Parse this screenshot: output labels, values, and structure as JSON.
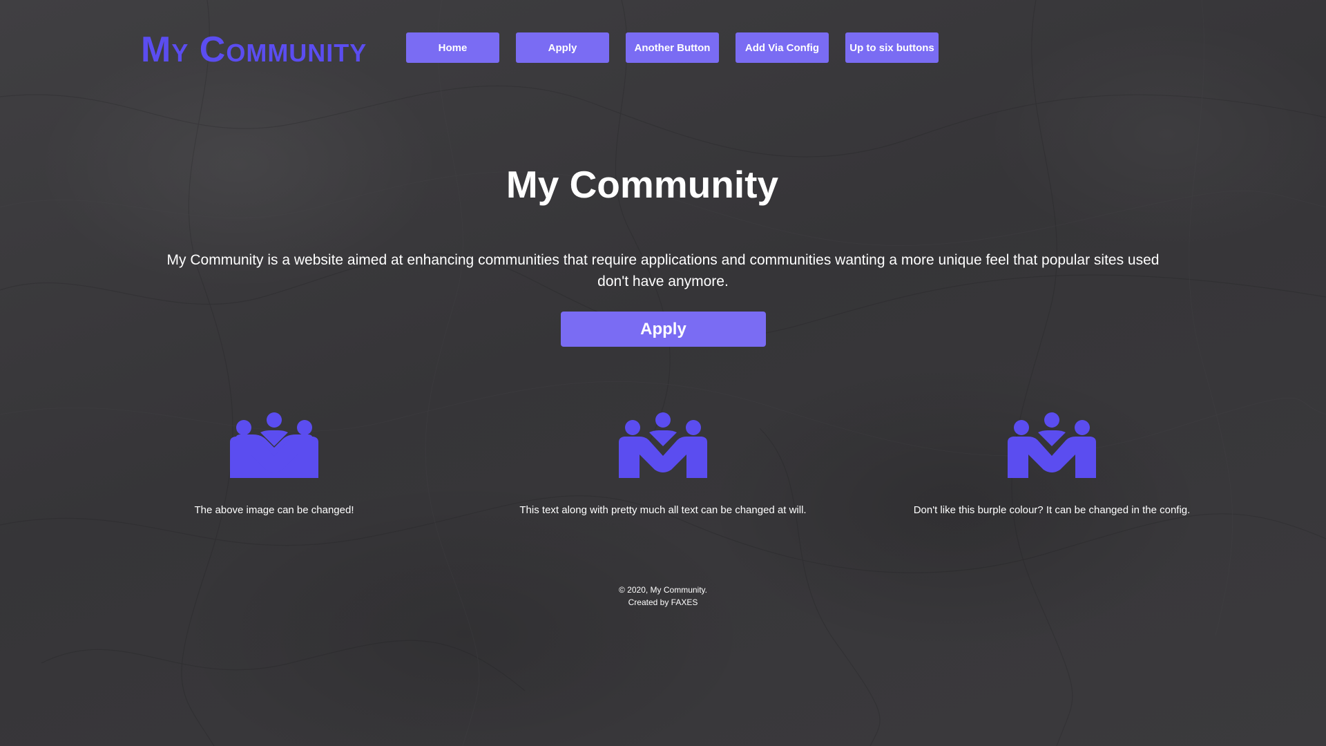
{
  "brand": {
    "logo_text": "My Community",
    "accent_color": "#5b4df0",
    "button_color": "#7a6cf3"
  },
  "nav": {
    "items": [
      {
        "label": "Home"
      },
      {
        "label": "Apply"
      },
      {
        "label": "Another Button"
      },
      {
        "label": "Add Via Config"
      },
      {
        "label": "Up to six buttons"
      }
    ]
  },
  "hero": {
    "title": "My Community",
    "description": "My Community is a website aimed at enhancing communities that require applications and communities wanting a more unique feel that popular sites used don't have anymore.",
    "apply_label": "Apply"
  },
  "features": [
    {
      "icon": "community-icon",
      "text": "The above image can be changed!"
    },
    {
      "icon": "community-icon",
      "text": "This text along with pretty much all text can be changed at will."
    },
    {
      "icon": "community-icon",
      "text": "Don't like this burple colour? It can be changed in the config."
    }
  ],
  "footer": {
    "copyright": "© 2020, My Community.",
    "credit": "Created by FAXES"
  }
}
